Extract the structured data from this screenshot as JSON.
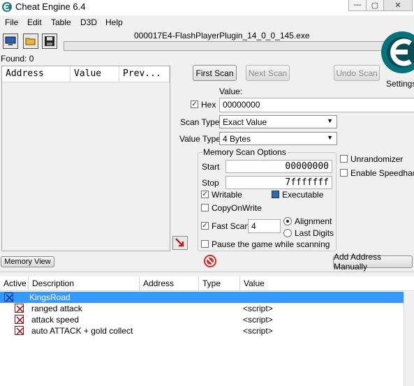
{
  "window": {
    "title": "Cheat Engine 6.4"
  },
  "menu": [
    "File",
    "Edit",
    "Table",
    "D3D",
    "Help"
  ],
  "process_name": "000017E4-FlashPlayerPlugin_14_0_0_145.exe",
  "found_label": "Found: 0",
  "results_columns": [
    "Address",
    "Value",
    "Prev..."
  ],
  "buttons": {
    "first_scan": "First Scan",
    "next_scan": "Next Scan",
    "undo_scan": "Undo Scan",
    "memory_view": "Memory View",
    "add_address": "Add Address Manually"
  },
  "settings_label": "Settings",
  "value_label": "Value:",
  "hex_label": "Hex",
  "hex_checked": true,
  "value_input": "00000000",
  "scan_type_label": "Scan Type",
  "scan_type_value": "Exact Value",
  "value_type_label": "Value Type",
  "value_type_value": "4 Bytes",
  "memory_scan_options": {
    "title": "Memory Scan Options",
    "start_label": "Start",
    "start_value": "00000000",
    "stop_label": "Stop",
    "stop_value": "7fffffff",
    "writable_label": "Writable",
    "executable_label": "Executable",
    "copyonwrite_label": "CopyOnWrite",
    "fast_scan_label": "Fast Scan",
    "fast_scan_value": "4",
    "alignment_label": "Alignment",
    "last_digits_label": "Last Digits",
    "pause_label": "Pause the game while scanning"
  },
  "unrandomizer_label": "Unrandomizer",
  "speedhack_label": "Enable Speedhack",
  "table_columns": [
    "Active",
    "Description",
    "Address",
    "Type",
    "Value"
  ],
  "cheat_table": [
    {
      "description": "KingsRoad",
      "value": "",
      "selected": true,
      "group": true
    },
    {
      "description": "ranged attack",
      "value": "<script>",
      "selected": false,
      "group": false
    },
    {
      "description": "attack speed",
      "value": "<script>",
      "selected": false,
      "group": false
    },
    {
      "description": "auto ATTACK + gold collect",
      "value": "<script>",
      "selected": false,
      "group": false
    }
  ],
  "colors": {
    "selection": "#3399ff",
    "accent_logo": "#00888a"
  }
}
